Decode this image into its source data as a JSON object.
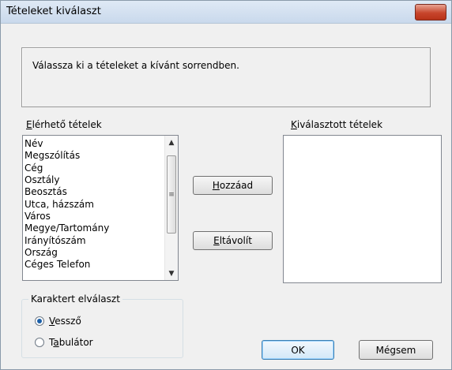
{
  "window": {
    "title": "Tételeket kiválaszt",
    "close_glyph": "✕"
  },
  "message": "Válassza ki a tételeket a kívánt sorrendben.",
  "available": {
    "label_mnemonic": "E",
    "label_rest": "lérhető tételek",
    "items": [
      "Név",
      "Megszólítás",
      "Cég",
      "Osztály",
      "Beosztás",
      "Utca, házszám",
      "Város",
      "Megye/Tartomány",
      "Irányítószám",
      "Ország",
      "Céges Telefon"
    ]
  },
  "selected": {
    "label_mnemonic": "K",
    "label_rest": "iválasztott tételek",
    "items": []
  },
  "buttons": {
    "add_mnemonic": "H",
    "add_rest": "ozzáad",
    "remove_mnemonic": "E",
    "remove_rest": "ltávolít",
    "ok": "OK",
    "cancel": "Mégsem"
  },
  "separator_group": {
    "title": "Karaktert elválaszt",
    "options": [
      {
        "mnemonic": "V",
        "rest": "essző",
        "checked": true
      },
      {
        "pre": "T",
        "mnemonic": "a",
        "rest": "bulátor",
        "checked": false
      }
    ]
  },
  "icons": {
    "scroll_up": "▲",
    "scroll_down": "▼",
    "thumb_grip": "≡"
  }
}
